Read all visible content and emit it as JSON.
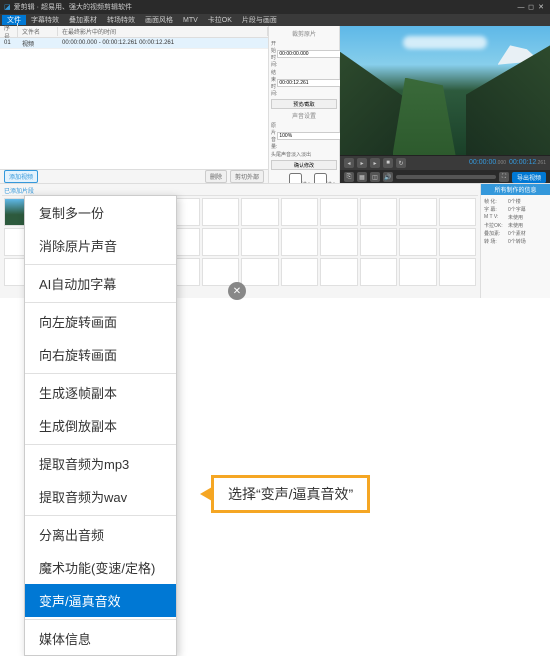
{
  "titlebar": {
    "app_name": "爱剪辑",
    "subtitle": "超易用、强大的视频剪辑软件"
  },
  "menubar": {
    "items": [
      "文件",
      "字幕特效",
      "叠加素材",
      "转场特效",
      "画面风格",
      "MTV",
      "卡拉OK",
      "片段与画面"
    ]
  },
  "timeline": {
    "headers": [
      "序号",
      "文件名",
      "在最终影片中的时间"
    ],
    "rows": [
      {
        "idx": "01",
        "file": "视频",
        "time": "00:00:00.000 - 00:00:12.261  00:00:12.261"
      }
    ],
    "add_btn": "添加视频",
    "del_btn": "删除",
    "ex_btn": "剪切外部"
  },
  "props": {
    "title": "裁剪原片",
    "start_label": "开始时间:",
    "start_val": "00:00:00.000",
    "end_label": "结束时间:",
    "end_val": "00:00:12.261",
    "preview_btn": "预览/截取",
    "audio_title": "声音设置",
    "vol_label": "原片音量:",
    "vol_val": "100%",
    "fade_label": "头尾声音淡入淡出",
    "confirm": "确认修改",
    "cb1": "选入",
    "cb2": "选入"
  },
  "player": {
    "time_cur": "00:00:00",
    "ms_cur": ".000",
    "time_dur": "00:00:12",
    "ms_dur": ".261",
    "export": "导出视频"
  },
  "storyboard": {
    "tab": "已添加片段",
    "info_title": "所有制作的信息",
    "info": [
      {
        "k": "帧 化:",
        "v": "0个楼"
      },
      {
        "k": "字 幕:",
        "v": "0个字幕"
      },
      {
        "k": "M T V:",
        "v": "未使用"
      },
      {
        "k": "卡拉OK:",
        "v": "未使用"
      },
      {
        "k": "叠加素:",
        "v": "0个素材"
      },
      {
        "k": "转 场:",
        "v": "0个转场"
      }
    ]
  },
  "context_menu": {
    "groups": [
      [
        "复制多一份",
        "消除原片声音"
      ],
      [
        "AI自动加字幕"
      ],
      [
        "向左旋转画面",
        "向右旋转画面"
      ],
      [
        "生成逐帧副本",
        "生成倒放副本"
      ],
      [
        "提取音频为mp3",
        "提取音频为wav"
      ],
      [
        "分离出音频",
        "魔术功能(变速/定格)",
        "变声/逼真音效"
      ],
      [
        "媒体信息"
      ]
    ],
    "highlighted": "变声/逼真音效"
  },
  "callout": {
    "text": "选择“变声/逼真音效”"
  }
}
